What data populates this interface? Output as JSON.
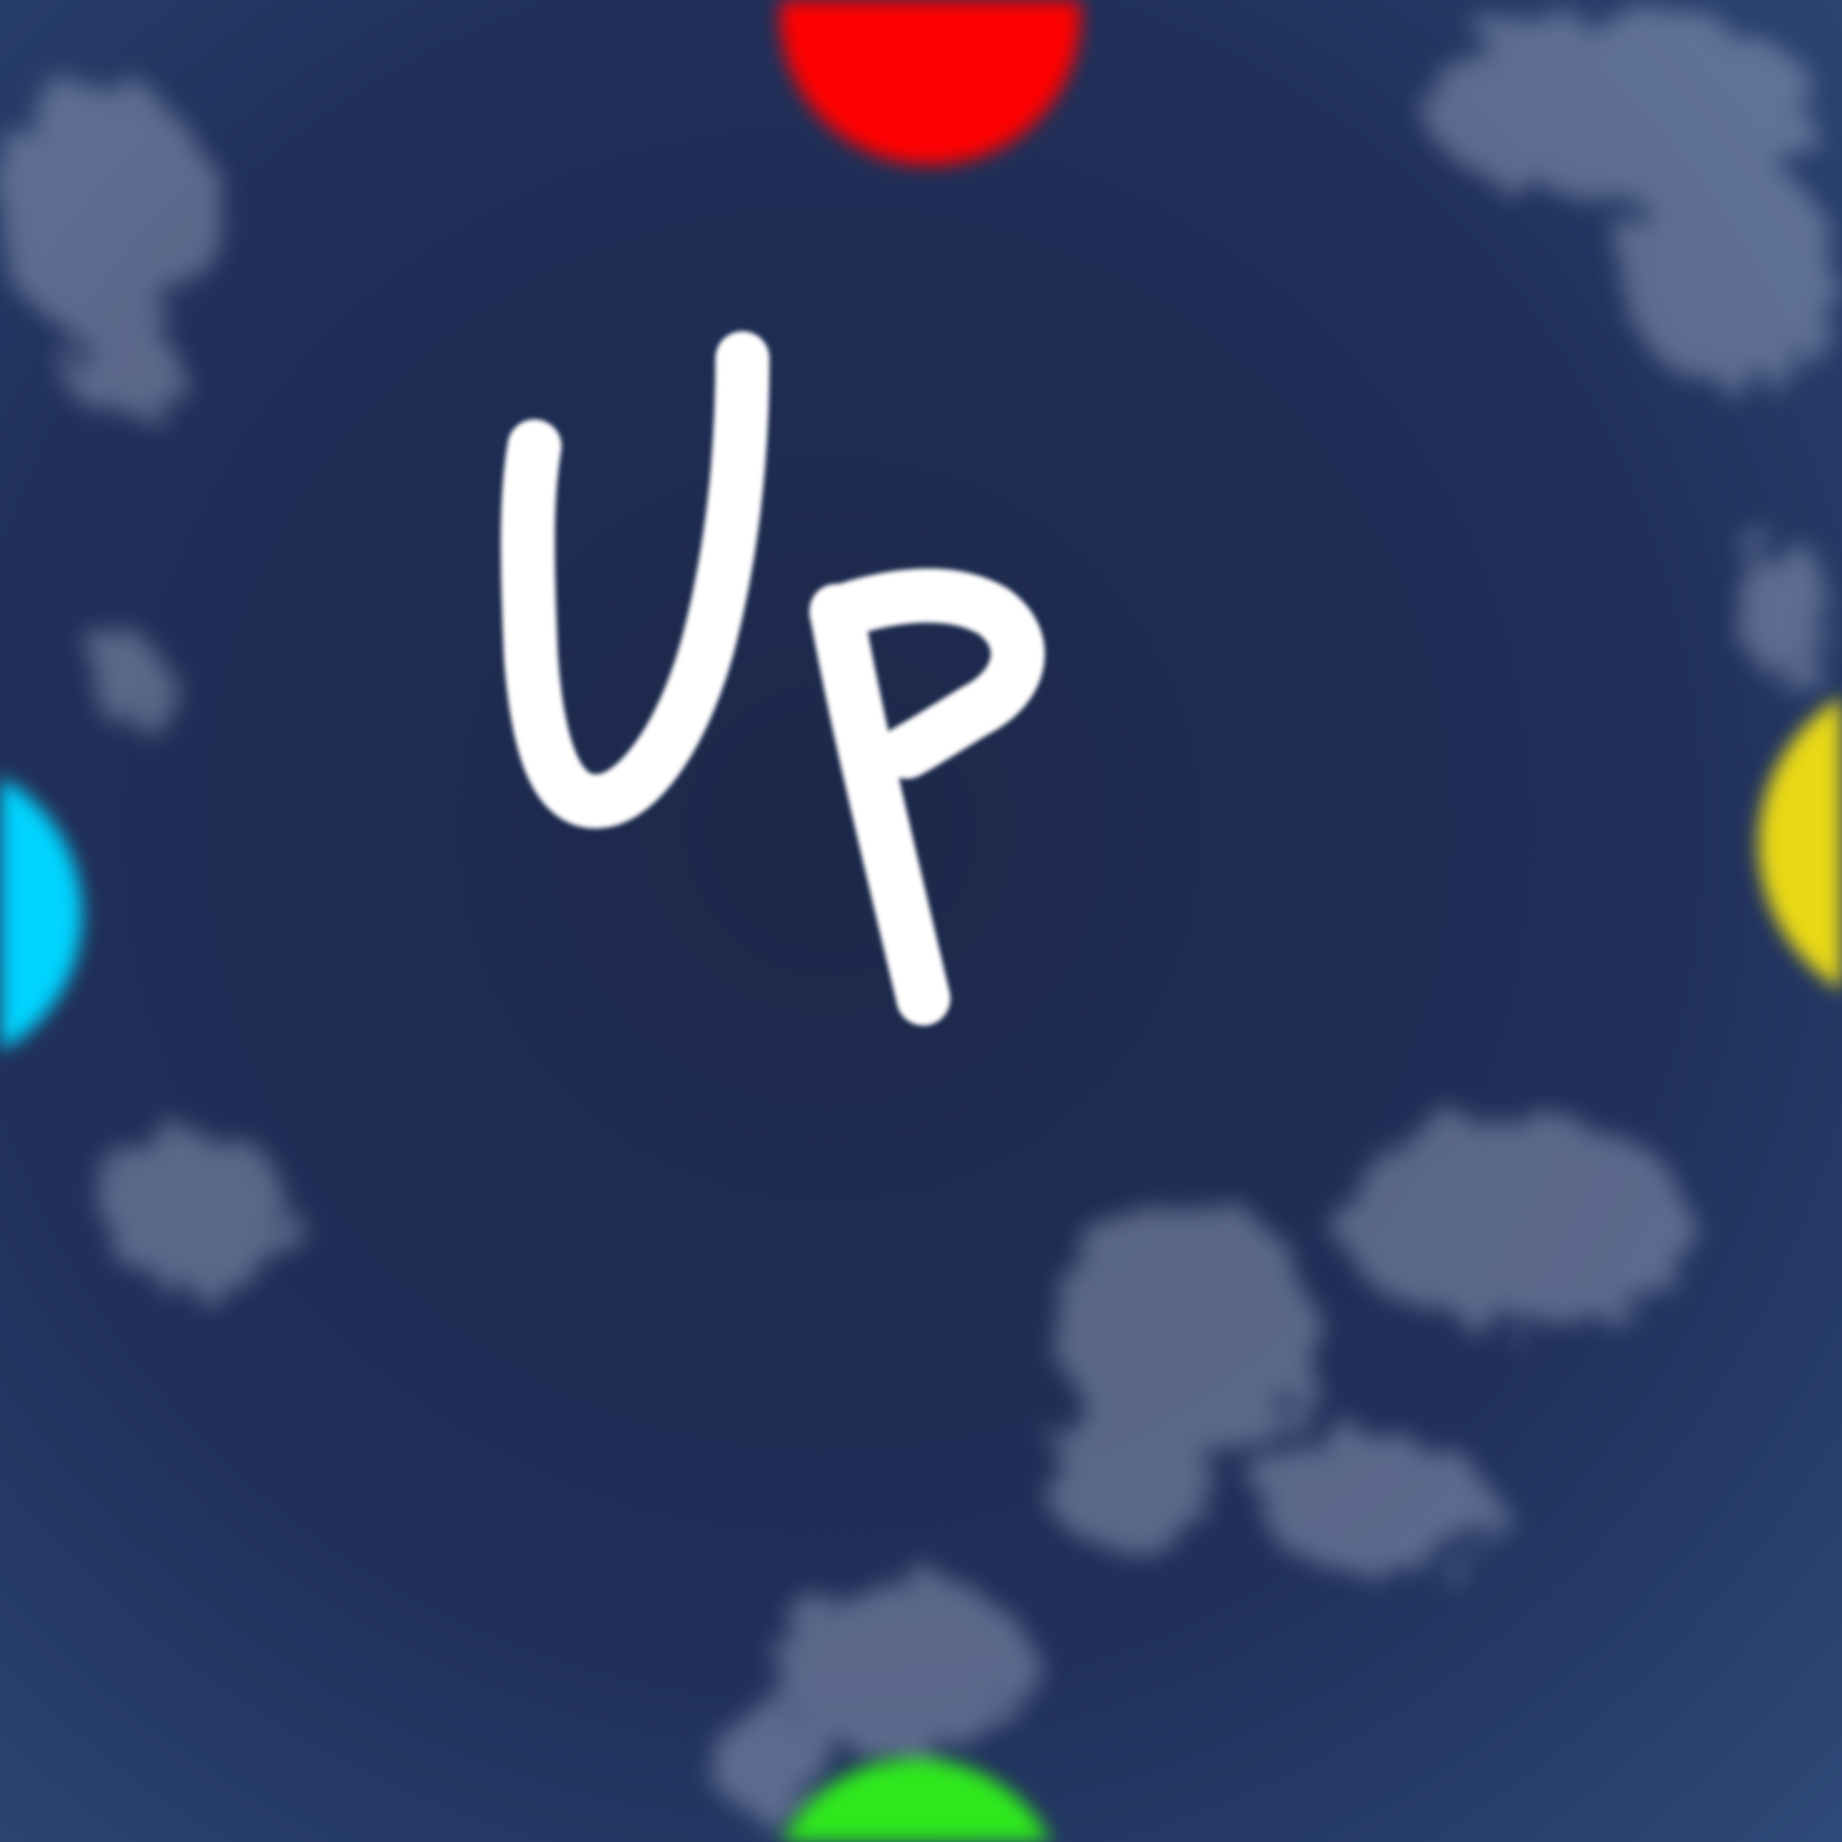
{
  "scene": {
    "handwritten_text": "Up",
    "background_color": "#1e2b4d",
    "stroke_color": "#ffffff",
    "targets": [
      {
        "name": "red",
        "color": "#ff0000",
        "position": "top"
      },
      {
        "name": "cyan",
        "color": "#00d4ff",
        "position": "left"
      },
      {
        "name": "yellow",
        "color": "#e8d818",
        "position": "right"
      },
      {
        "name": "green",
        "color": "#2ee81a",
        "position": "bottom"
      }
    ]
  }
}
